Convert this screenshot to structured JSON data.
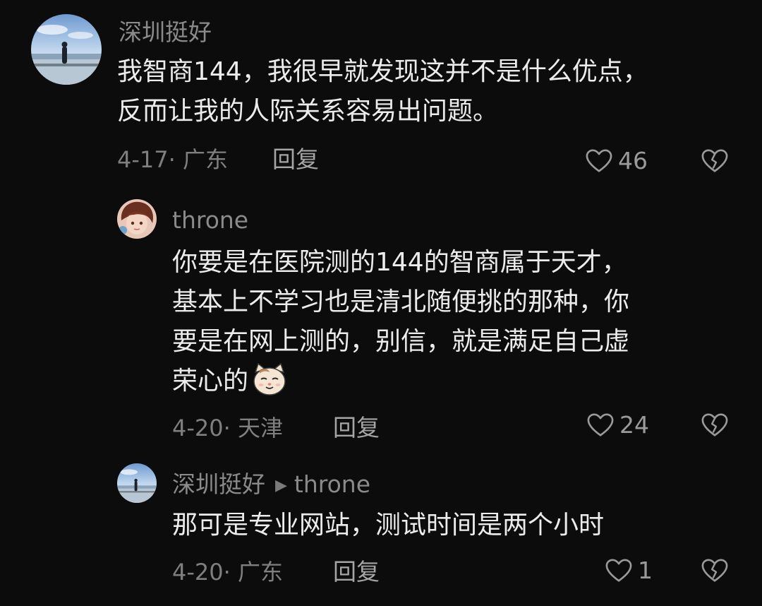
{
  "comments": [
    {
      "username": "深圳挺好",
      "text": "我智商144，我很早就发现这并不是什么优点，\n反而让我的人际关系容易出问题。",
      "meta": "4-17· 广东",
      "reply_label": "回复",
      "likes": "46",
      "avatar_icon": "lakeside-person-avatar"
    },
    {
      "username": "throne",
      "text": "你要是在医院测的144的智商属于天才，\n基本上不学习也是清北随便挑的那种，你\n要是在网上测的，别信，就是满足自己虚\n荣心的",
      "meta": "4-20· 天津",
      "reply_label": "回复",
      "likes": "24",
      "avatar_icon": "anime-boy-avatar",
      "emoji_icon": "cat-emoji"
    },
    {
      "username": "深圳挺好",
      "reply_to": "throne",
      "text": "那可是专业网站，测试时间是两个小时",
      "meta": "4-20· 广东",
      "reply_label": "回复",
      "likes": "1",
      "avatar_icon": "lakeside-person-avatar"
    }
  ],
  "colors": {
    "background": "#0c0c0c",
    "text": "#ececec",
    "muted": "#8a8a8a"
  }
}
